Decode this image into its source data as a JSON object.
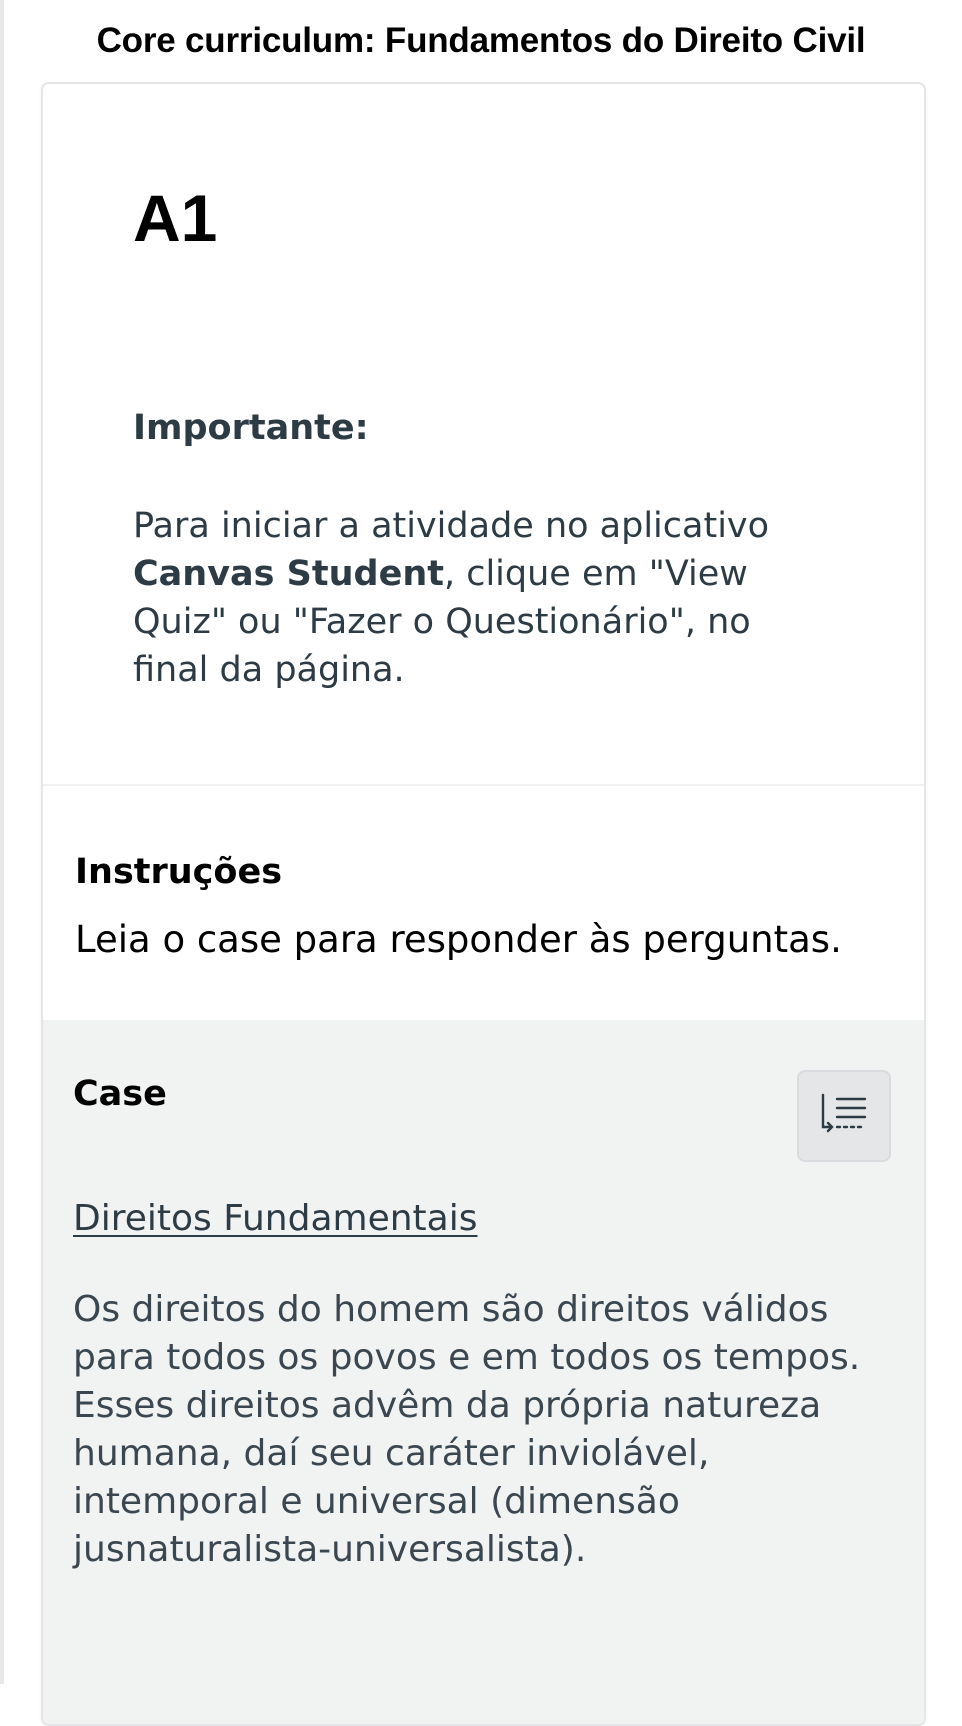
{
  "header": {
    "title": "Core curriculum: Fundamentos do Direito Civil"
  },
  "quiz": {
    "title": "A1",
    "important_label": "Importante:",
    "important_text_1": "Para iniciar a atividade no aplicativo ",
    "important_text_bold": "Canvas Student",
    "important_text_2": ", clique em \"View Quiz\" ou \"Fazer o Questionário\", no final da página."
  },
  "instructions": {
    "title": "Instruções",
    "text": "Leia o case para responder às perguntas."
  },
  "case": {
    "title": "Case",
    "toc_icon": "table-of-contents-icon",
    "link_text": "Direitos Fundamentais",
    "body": "Os direitos do homem são direitos válidos para todos os povos e em todos os tempos. Esses direitos advêm da própria natureza humana, daí seu caráter inviolável, intemporal e universal (dimensão jusnaturalista-universalista)."
  },
  "colors": {
    "text_primary": "#2d3b45",
    "case_background": "#f1f2f2",
    "card_border": "#e3e5e7"
  }
}
